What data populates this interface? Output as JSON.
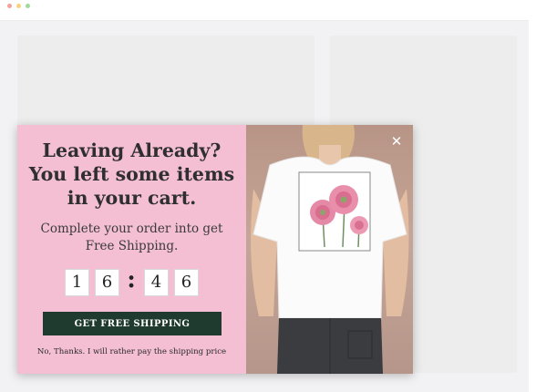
{
  "popup": {
    "headline": [
      "Leaving Already?",
      "You left some items",
      "in your cart."
    ],
    "subtitle": [
      "Complete your order into get",
      "Free Shipping."
    ],
    "timer": {
      "d1": "1",
      "d2": "6",
      "d3": "4",
      "d4": "6"
    },
    "cta_label": "GET FREE SHIPPING",
    "decline_label": "No, Thanks. I will rather pay the shipping price",
    "close_symbol": "✕"
  },
  "colors": {
    "popup_bg": "#f4bfd3",
    "cta_bg": "#1f3a2e",
    "page_bg": "#f2f2f4",
    "placeholder_card": "#ededed"
  },
  "icons": [
    "close-icon",
    "flower-print-icon"
  ]
}
